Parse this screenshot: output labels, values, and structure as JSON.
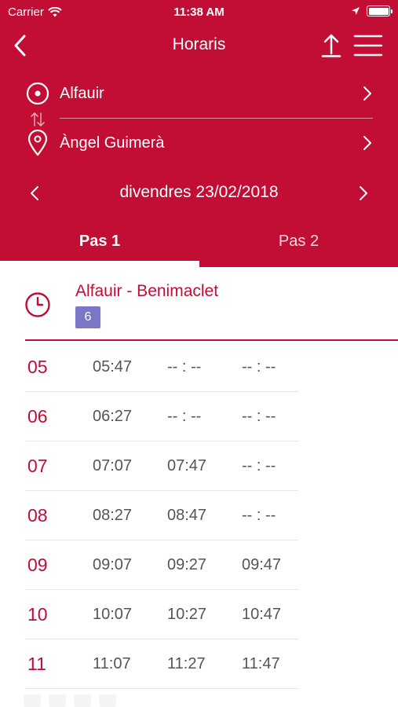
{
  "status_bar": {
    "carrier": "Carrier",
    "time": "11:38 AM"
  },
  "nav": {
    "title": "Horaris",
    "back_icon": "chevron-left-icon",
    "share_icon": "share-upload-icon",
    "menu_icon": "hamburger-menu-icon"
  },
  "route": {
    "origin": "Alfauir",
    "destination": "Àngel Guimerà"
  },
  "date": {
    "label": "divendres 23/02/2018"
  },
  "tabs": [
    {
      "label": "Pas 1",
      "selected": true
    },
    {
      "label": "Pas 2",
      "selected": false
    }
  ],
  "line": {
    "name": "Alfauir - Benimaclet",
    "badge": "6",
    "badge_color": "#7b77c6"
  },
  "schedule": [
    {
      "hour": "05",
      "times": [
        "05:47",
        "-- : --",
        "-- : --"
      ]
    },
    {
      "hour": "06",
      "times": [
        "06:27",
        "-- : --",
        "-- : --"
      ]
    },
    {
      "hour": "07",
      "times": [
        "07:07",
        "07:47",
        "-- : --"
      ]
    },
    {
      "hour": "08",
      "times": [
        "08:27",
        "08:47",
        "-- : --"
      ]
    },
    {
      "hour": "09",
      "times": [
        "09:07",
        "09:27",
        "09:47"
      ]
    },
    {
      "hour": "10",
      "times": [
        "10:07",
        "10:27",
        "10:47"
      ]
    },
    {
      "hour": "11",
      "times": [
        "11:07",
        "11:27",
        "11:47"
      ]
    }
  ],
  "colors": {
    "brand": "#c20d35",
    "text_muted": "#555555"
  }
}
